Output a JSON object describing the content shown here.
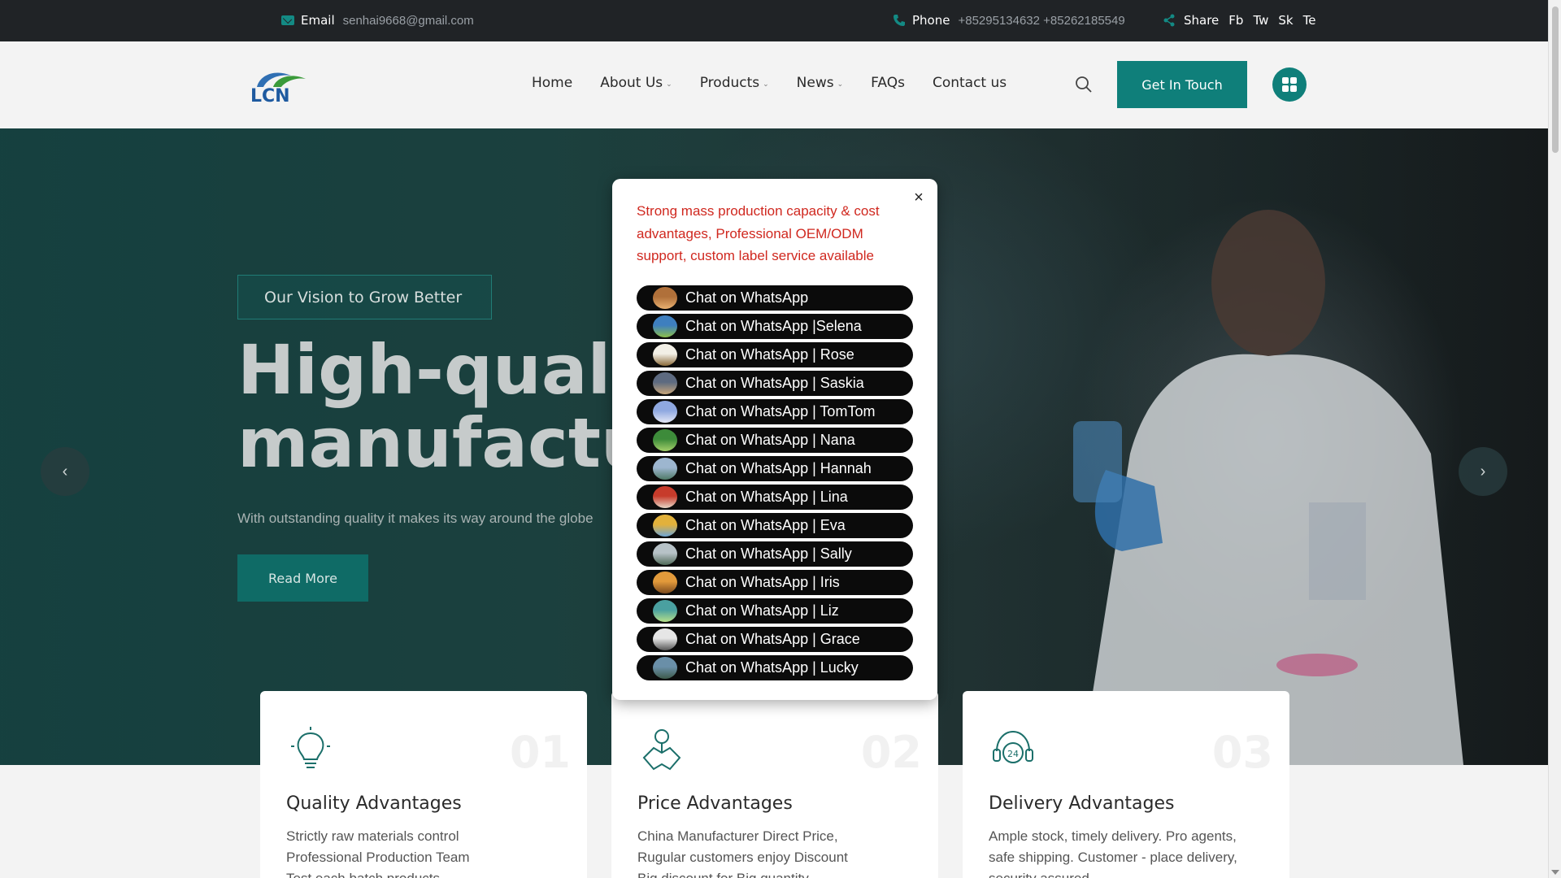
{
  "topbar": {
    "email_label": "Email",
    "email_value": "senhai9668@gmail.com",
    "phone_label": "Phone",
    "phone_value": "+85295134632 +85262185549",
    "share_label": "Share",
    "share_links": [
      "Fb",
      "Tw",
      "Sk",
      "Te"
    ]
  },
  "header": {
    "logo_text": "LCN",
    "nav": [
      {
        "label": "Home",
        "dropdown": false
      },
      {
        "label": "About Us",
        "dropdown": true
      },
      {
        "label": "Products",
        "dropdown": true
      },
      {
        "label": "News",
        "dropdown": true
      },
      {
        "label": "FAQs",
        "dropdown": false
      },
      {
        "label": "Contact us",
        "dropdown": false
      }
    ],
    "cta_label": "Get In Touch",
    "icons": {
      "search": "search-icon",
      "grid": "grid-icon"
    },
    "accent_color": "#0f7f7a"
  },
  "hero": {
    "tagline": "Our Vision to Grow Better",
    "headline_line1": "High-qualit",
    "headline_line2": "manufactur",
    "subtext": "With outstanding quality it makes its way around the globe",
    "button_label": "Read More",
    "prev_arrow": "‹",
    "next_arrow": "›"
  },
  "cards": [
    {
      "number": "01",
      "title": "Quality Advantages",
      "icon": "lightbulb-icon",
      "lines": [
        "Strictly raw materials control",
        "Professional Production Team",
        "Test each batch products"
      ]
    },
    {
      "number": "02",
      "title": "Price Advantages",
      "icon": "handshake-icon",
      "lines": [
        "China Manufacturer Direct Price,",
        "Rugular customers enjoy Discount",
        "Big discount for Big quantity"
      ]
    },
    {
      "number": "03",
      "title": "Delivery Advantages",
      "icon": "support-24-icon",
      "lines": [
        "Ample stock, timely delivery. Pro agents,",
        "safe shipping. Customer - place delivery,",
        "security assured."
      ]
    }
  ],
  "popup": {
    "close_label": "×",
    "message": "Strong mass production capacity & cost advantages, Professional OEM/ODM support, custom label service available",
    "message_color": "#d0281f",
    "contacts": [
      {
        "label": "Chat on WhatsApp",
        "avatar_colors": [
          "#b0703a",
          "#e8b070"
        ]
      },
      {
        "label": "Chat on WhatsApp |Selena",
        "avatar_colors": [
          "#3e7fbf",
          "#8cbf4a"
        ]
      },
      {
        "label": "Chat on WhatsApp | Rose",
        "avatar_colors": [
          "#f2efe6",
          "#8a6b3a"
        ]
      },
      {
        "label": "Chat on WhatsApp | Saskia",
        "avatar_colors": [
          "#5d6a80",
          "#c9a77b"
        ]
      },
      {
        "label": "Chat on WhatsApp | TomTom",
        "avatar_colors": [
          "#8fa8e0",
          "#e4e8f5"
        ]
      },
      {
        "label": "Chat on WhatsApp | Nana",
        "avatar_colors": [
          "#3d8b3a",
          "#a4d06a"
        ]
      },
      {
        "label": "Chat on WhatsApp | Hannah",
        "avatar_colors": [
          "#9db6cf",
          "#4f7a66"
        ]
      },
      {
        "label": "Chat on WhatsApp | Lina",
        "avatar_colors": [
          "#c73b2b",
          "#e6d6c6"
        ]
      },
      {
        "label": "Chat on WhatsApp | Eva",
        "avatar_colors": [
          "#e2b13b",
          "#6ea6d6"
        ]
      },
      {
        "label": "Chat on WhatsApp | Sally",
        "avatar_colors": [
          "#b7c2c7",
          "#4f6a58"
        ]
      },
      {
        "label": "Chat on WhatsApp | Iris",
        "avatar_colors": [
          "#e29a3b",
          "#7a4a1e"
        ]
      },
      {
        "label": "Chat on WhatsApp | Liz",
        "avatar_colors": [
          "#4aa0a0",
          "#b6e08a"
        ]
      },
      {
        "label": "Chat on WhatsApp | Grace",
        "avatar_colors": [
          "#e6e6e6",
          "#555555"
        ]
      },
      {
        "label": "Chat on WhatsApp | Lucky",
        "avatar_colors": [
          "#6a8fa8",
          "#3d5a4a"
        ]
      }
    ]
  }
}
